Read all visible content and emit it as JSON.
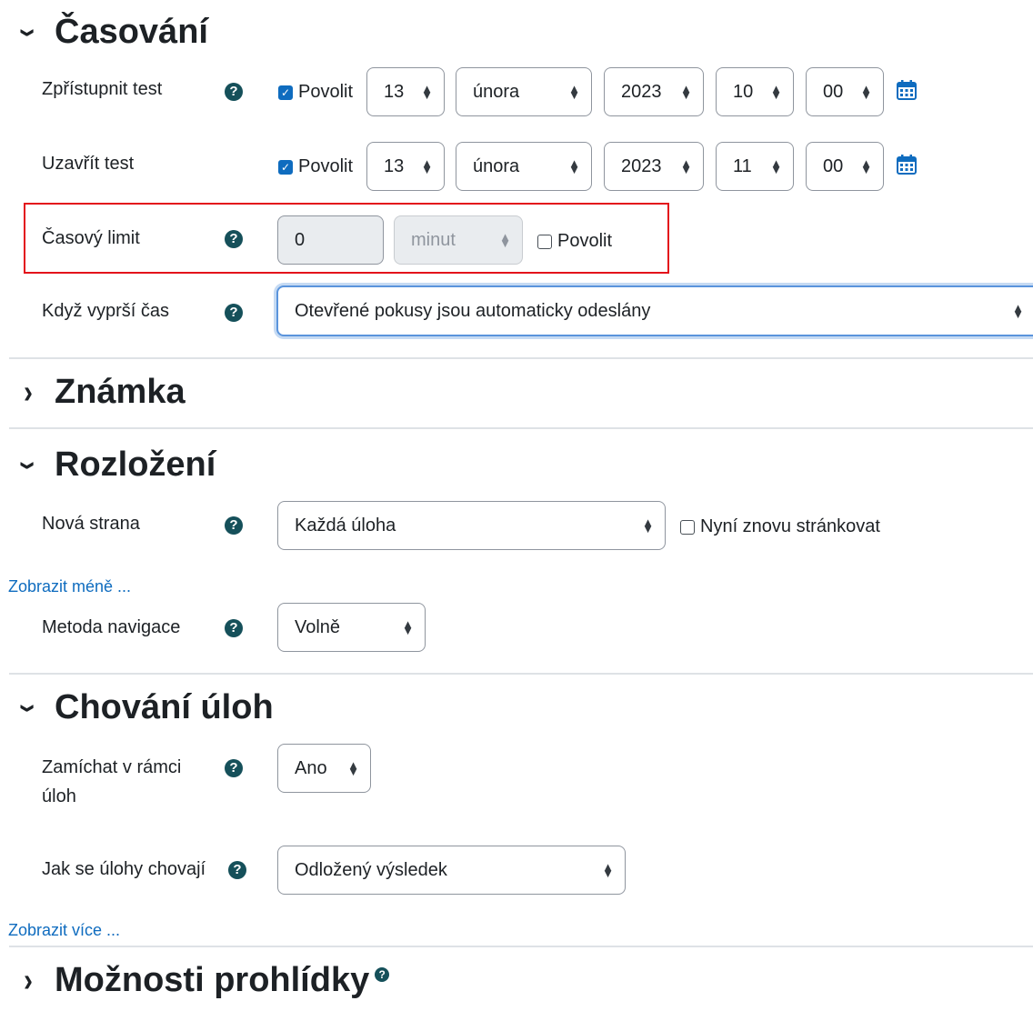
{
  "timing": {
    "section_title": "Časování",
    "open": {
      "label": "Zpřístupnit test",
      "enable_label": "Povolit",
      "day": "13",
      "month": "února",
      "year": "2023",
      "hour": "10",
      "minute": "00"
    },
    "close": {
      "label": "Uzavřít test",
      "enable_label": "Povolit",
      "day": "13",
      "month": "února",
      "year": "2023",
      "hour": "11",
      "minute": "00"
    },
    "time_limit": {
      "label": "Časový limit",
      "value": "0",
      "unit": "minut",
      "enable_label": "Povolit"
    },
    "when_expires": {
      "label": "Když vyprší čas",
      "value": "Otevřené pokusy jsou automaticky odeslány"
    }
  },
  "grade": {
    "section_title": "Známka"
  },
  "layout": {
    "section_title": "Rozložení",
    "new_page": {
      "label": "Nová strana",
      "value": "Každá úloha",
      "repaginate_label": "Nyní znovu stránkovat"
    },
    "show_less": "Zobrazit méně ...",
    "nav_method": {
      "label": "Metoda navigace",
      "value": "Volně"
    }
  },
  "question_behaviour": {
    "section_title": "Chování úloh",
    "shuffle": {
      "label_line1": "Zamíchat v rámci",
      "label_line2": "úloh",
      "value": "Ano"
    },
    "how_behave": {
      "label": "Jak se úlohy chovají",
      "value": "Odložený výsledek"
    },
    "show_more": "Zobrazit více ..."
  },
  "review": {
    "section_title": "Možnosti prohlídky"
  },
  "icons": {
    "help": "question-circle-icon",
    "calendar": "calendar-icon",
    "select": "select-arrows-icon"
  },
  "colors": {
    "help_icon": "#15505a",
    "checkbox": "#0f6cbf",
    "link": "#0f6cbf",
    "highlight_box": "#e3121b",
    "focus": "#5a94dc"
  }
}
